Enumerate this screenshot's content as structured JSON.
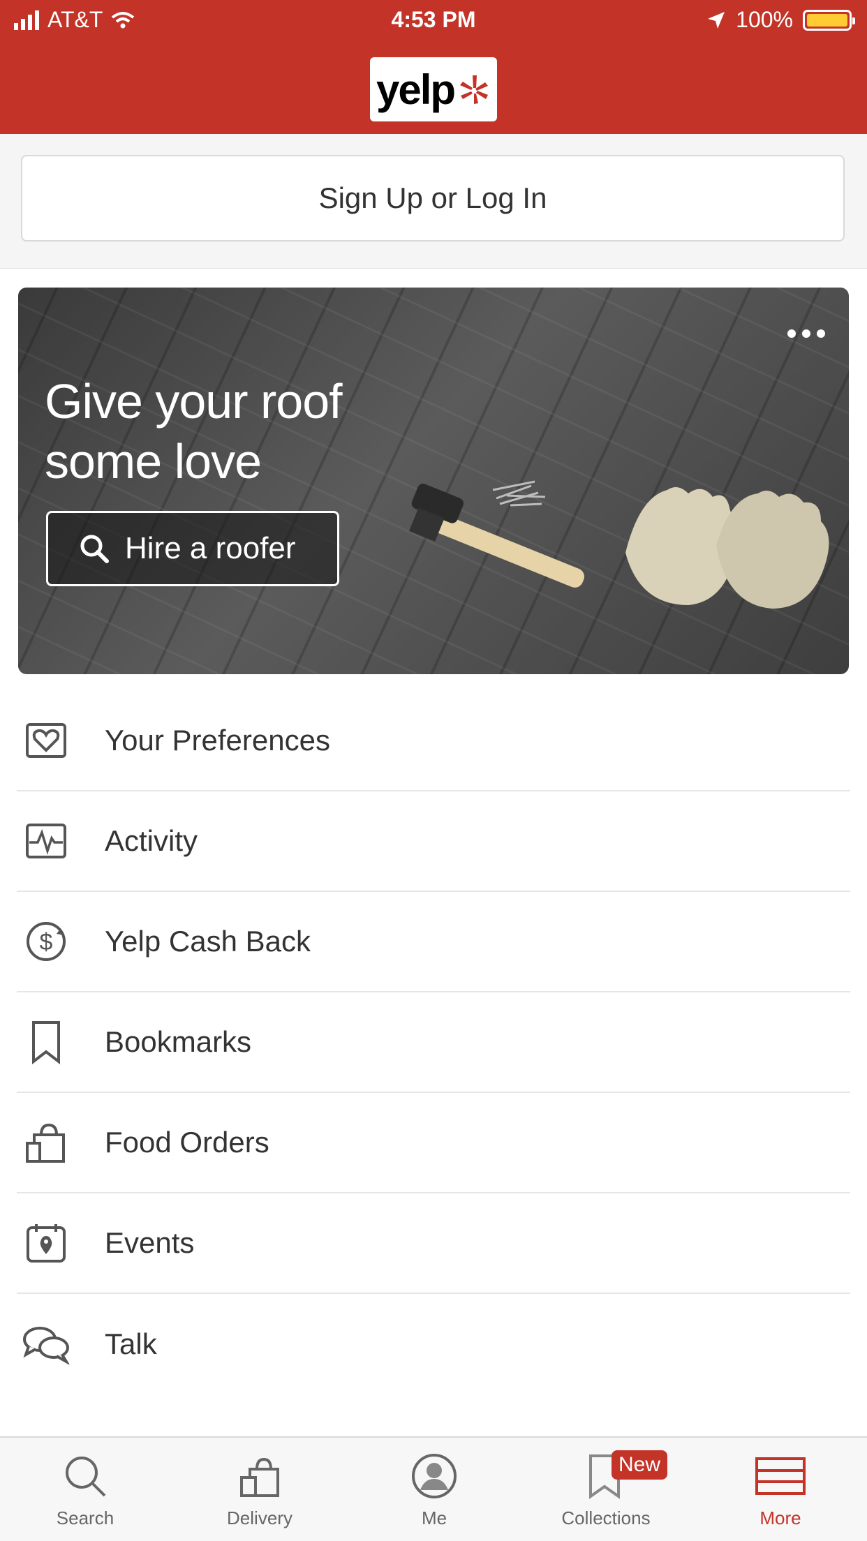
{
  "status_bar": {
    "carrier": "AT&T",
    "time": "4:53 PM",
    "battery": "100%"
  },
  "header": {
    "logo_text": "yelp"
  },
  "signup": {
    "label": "Sign Up or Log In"
  },
  "hero": {
    "title": "Give your roof some love",
    "button_label": "Hire a roofer"
  },
  "list": {
    "items": [
      {
        "label": "Your Preferences",
        "icon": "heart-icon"
      },
      {
        "label": "Activity",
        "icon": "activity-icon"
      },
      {
        "label": "Yelp Cash Back",
        "icon": "dollar-icon"
      },
      {
        "label": "Bookmarks",
        "icon": "bookmark-icon"
      },
      {
        "label": "Food Orders",
        "icon": "food-bag-icon"
      },
      {
        "label": "Events",
        "icon": "event-calendar-icon"
      },
      {
        "label": "Talk",
        "icon": "chat-bubbles-icon"
      }
    ]
  },
  "tabbar": {
    "tabs": [
      {
        "label": "Search",
        "icon": "search-icon"
      },
      {
        "label": "Delivery",
        "icon": "delivery-bag-icon"
      },
      {
        "label": "Me",
        "icon": "profile-icon"
      },
      {
        "label": "Collections",
        "icon": "collections-icon",
        "badge": "New"
      },
      {
        "label": "More",
        "icon": "menu-icon",
        "active": true
      }
    ]
  },
  "colors": {
    "brand_red": "#c33328",
    "text_dark": "#333333"
  }
}
